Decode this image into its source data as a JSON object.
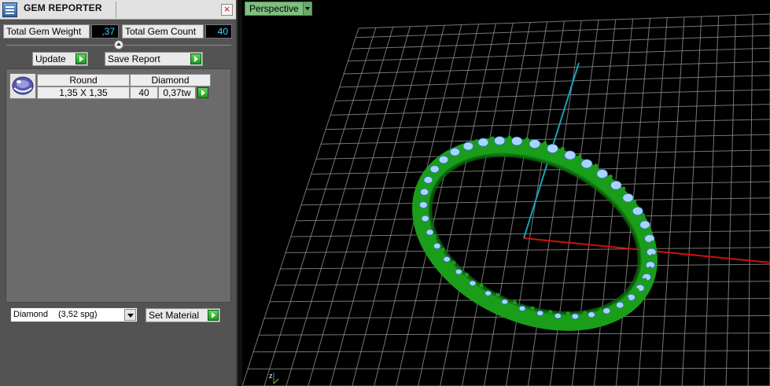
{
  "app": {
    "title": "GEM REPORTER",
    "close_label": "×"
  },
  "totals": {
    "weight_label": "Total Gem Weight",
    "weight_value": ",37",
    "count_label": "Total Gem Count",
    "count_value": "40"
  },
  "actions": {
    "update_label": "Update",
    "save_report_label": "Save Report"
  },
  "gem_list": {
    "rows": [
      {
        "shape": "Round",
        "type": "Diamond",
        "size": "1,35 X 1,35",
        "count": "40",
        "weight": "0,37tw"
      }
    ]
  },
  "material": {
    "selected_name": "Diamond",
    "selected_spec": "(3,52 spg)",
    "set_material_label": "Set Material"
  },
  "viewport": {
    "view_mode": "Perspective",
    "axis_label": "z"
  },
  "colors": {
    "ring": "#1a9e1a",
    "gem": "#a8d4ff",
    "grid": "#8a8a8a",
    "axis_x": "#d01010",
    "axis_z": "#1aa3b8",
    "value_text": "#3fd3ff"
  },
  "icons": {
    "app": "gem-reporter-app-icon",
    "thumb": "round-gem-icon",
    "go": "green-arrow-icon",
    "dropdown": "chevron-down-icon",
    "collapse": "collapse-up-icon"
  }
}
